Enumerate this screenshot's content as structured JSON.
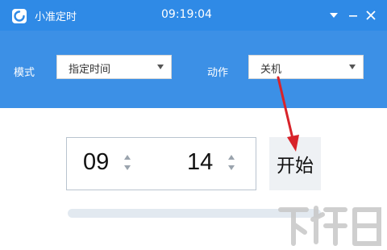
{
  "window": {
    "title": "小准定时",
    "clock": "09:19:04",
    "accent_color": "#2f8ae6",
    "icons": [
      "app-logo-icon",
      "dropdown-icon",
      "minimize-icon",
      "close-icon"
    ]
  },
  "toolbar": {
    "mode_label": "模式",
    "mode_value": "指定时间",
    "action_label": "动作",
    "action_value": "关机"
  },
  "timer": {
    "hour": "09",
    "minute": "14",
    "start_label": "开始",
    "progress": 0.0
  },
  "watermark": {
    "text": "下载吧"
  }
}
